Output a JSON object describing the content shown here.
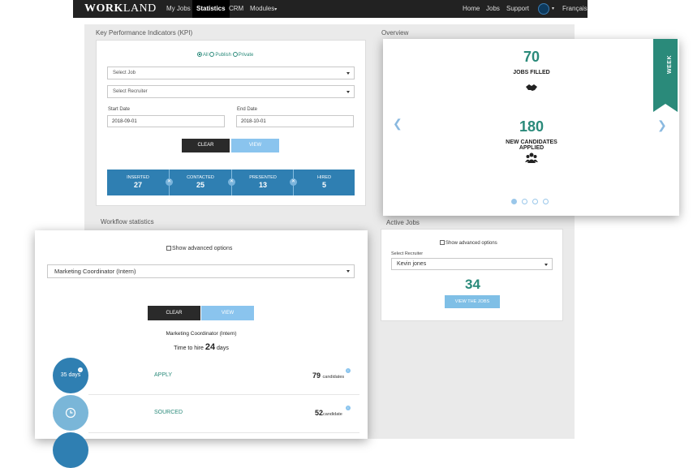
{
  "nav": {
    "logo_bold": "WORK",
    "logo_rest": "LAND",
    "left_items": [
      "My Jobs",
      "Statistics",
      "CRM",
      "Modules"
    ],
    "right_items": [
      "Home",
      "Jobs",
      "Support"
    ],
    "language": "Français"
  },
  "kpi": {
    "title": "Key Performance Indicators (KPI)",
    "radios": [
      "All",
      "Publish",
      "Private"
    ],
    "select_job": "Select Job",
    "select_recruiter": "Select Recruiter",
    "start_label": "Start Date",
    "start_value": "2018-09-01",
    "end_label": "End Date",
    "end_value": "2018-10-01",
    "clear": "CLEAR",
    "view": "VIEW",
    "stats": [
      {
        "label": "INSERTED",
        "value": "27"
      },
      {
        "label": "CONTACTED",
        "value": "25"
      },
      {
        "label": "PRESENTED",
        "value": "13"
      },
      {
        "label": "HIRED",
        "value": "5"
      }
    ]
  },
  "overview": {
    "title": "Overview",
    "ribbon": "WEEK",
    "jobs_filled_value": "70",
    "jobs_filled_label": "JOBS FILLED",
    "new_candidates_value": "180",
    "new_candidates_label_1": "NEW CANDIDATES",
    "new_candidates_label_2": "APPLIED"
  },
  "workflow": {
    "title": "Workflow statistics",
    "advanced": "Show advanced options",
    "job_select": "Marketing Coordinator (Intern)",
    "clear": "CLEAR",
    "view": "VIEW",
    "job_name": "Marketing Coordinator (Intern)",
    "time_prefix": "Time to hire",
    "time_value": "24",
    "time_unit": "days",
    "rows": [
      {
        "circle": "35 days",
        "stage": "APPLY",
        "count": "79",
        "unit": "candidates",
        "color": "#2f7fb2"
      },
      {
        "circle": "",
        "stage": "SOURCED",
        "count": "52",
        "unit": "candidate",
        "color": "#7ab6d8"
      }
    ]
  },
  "active": {
    "title": "Active Jobs",
    "advanced": "Show advanced options",
    "recruiter_label": "Select Recruiter",
    "recruiter_value": "Kevin jones",
    "count": "34",
    "button": "VIEW THE JOBS"
  },
  "colors": {
    "accent": "#2a8a7a",
    "blue": "#2f7fb2",
    "light_blue": "#8ac4ee",
    "nav": "#222222"
  }
}
